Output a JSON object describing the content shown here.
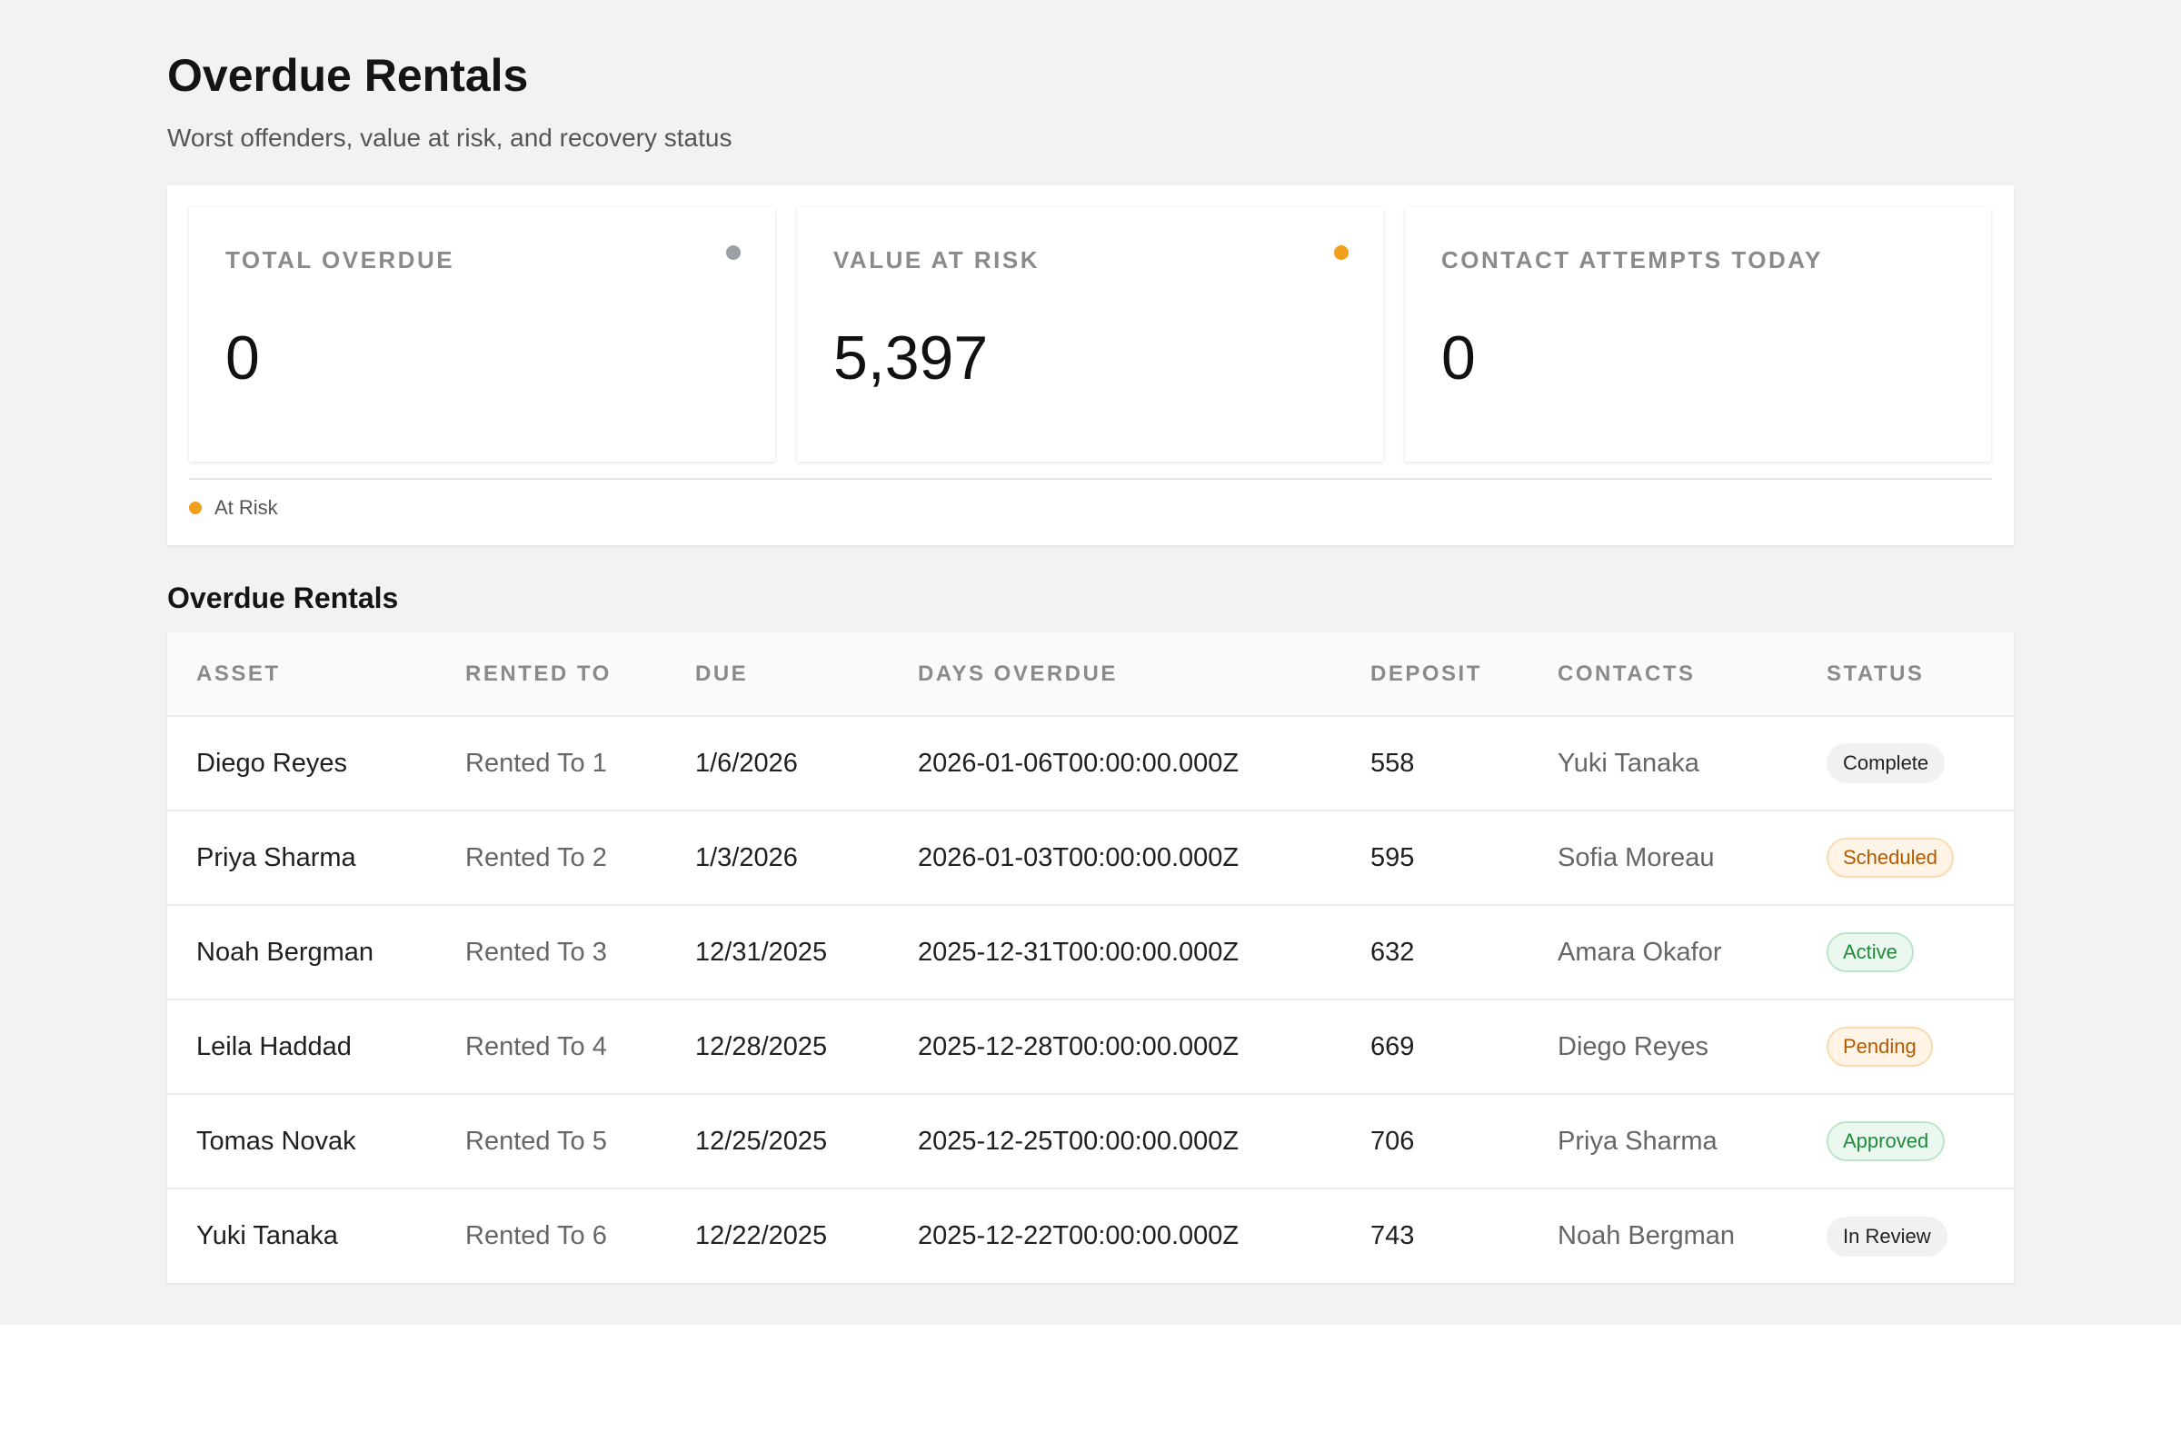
{
  "header": {
    "title": "Overdue Rentals",
    "subtitle": "Worst offenders, value at risk, and recovery status"
  },
  "kpis": [
    {
      "label": "TOTAL OVERDUE",
      "value": "0",
      "dot_color": "#9aa0a6"
    },
    {
      "label": "VALUE AT RISK",
      "value": "5,397",
      "dot_color": "#f0a01a"
    },
    {
      "label": "CONTACT ATTEMPTS TODAY",
      "value": "0",
      "dot_color": null
    }
  ],
  "legend": {
    "label": "At Risk",
    "color": "#f0a01a"
  },
  "table": {
    "title": "Overdue Rentals",
    "columns": [
      "ASSET",
      "RENTED TO",
      "DUE",
      "DAYS OVERDUE",
      "DEPOSIT",
      "CONTACTS",
      "STATUS"
    ],
    "rows": [
      {
        "asset": "Diego Reyes",
        "rented_to": "Rented To 1",
        "due": "1/6/2026",
        "days_overdue": "2026-01-06T00:00:00.000Z",
        "deposit": "558",
        "contacts": "Yuki Tanaka",
        "status": "Complete",
        "status_kind": "neutral"
      },
      {
        "asset": "Priya Sharma",
        "rented_to": "Rented To 2",
        "due": "1/3/2026",
        "days_overdue": "2026-01-03T00:00:00.000Z",
        "deposit": "595",
        "contacts": "Sofia Moreau",
        "status": "Scheduled",
        "status_kind": "warn"
      },
      {
        "asset": "Noah Bergman",
        "rented_to": "Rented To 3",
        "due": "12/31/2025",
        "days_overdue": "2025-12-31T00:00:00.000Z",
        "deposit": "632",
        "contacts": "Amara Okafor",
        "status": "Active",
        "status_kind": "good"
      },
      {
        "asset": "Leila Haddad",
        "rented_to": "Rented To 4",
        "due": "12/28/2025",
        "days_overdue": "2025-12-28T00:00:00.000Z",
        "deposit": "669",
        "contacts": "Diego Reyes",
        "status": "Pending",
        "status_kind": "warn"
      },
      {
        "asset": "Tomas Novak",
        "rented_to": "Rented To 5",
        "due": "12/25/2025",
        "days_overdue": "2025-12-25T00:00:00.000Z",
        "deposit": "706",
        "contacts": "Priya Sharma",
        "status": "Approved",
        "status_kind": "good"
      },
      {
        "asset": "Yuki Tanaka",
        "rented_to": "Rented To 6",
        "due": "12/22/2025",
        "days_overdue": "2025-12-22T00:00:00.000Z",
        "deposit": "743",
        "contacts": "Noah Bergman",
        "status": "In Review",
        "status_kind": "neutral"
      }
    ]
  }
}
